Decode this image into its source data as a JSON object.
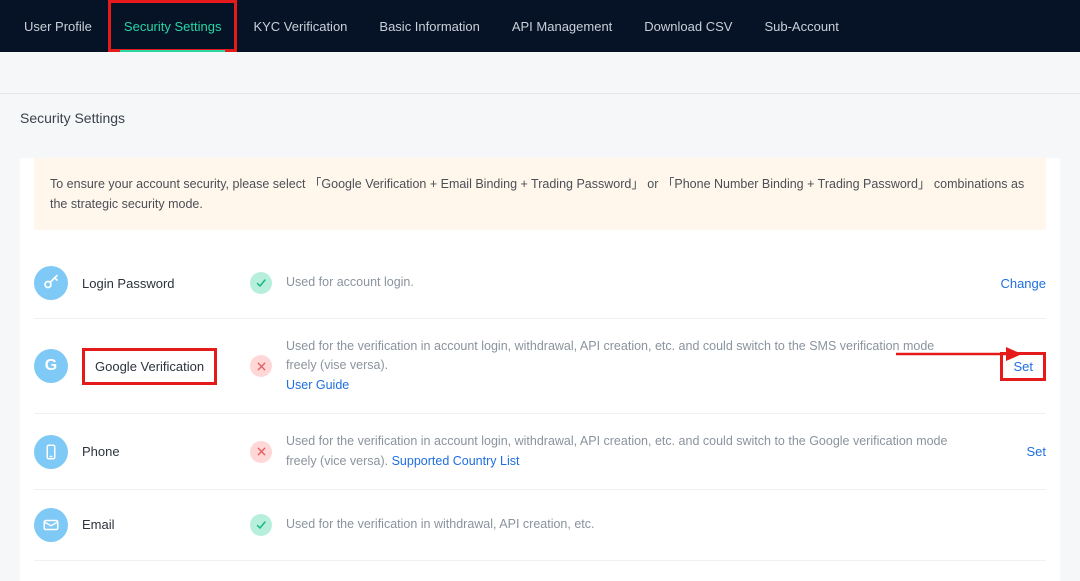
{
  "nav": {
    "tabs": [
      {
        "label": "User Profile"
      },
      {
        "label": "Security Settings"
      },
      {
        "label": "KYC Verification"
      },
      {
        "label": "Basic Information"
      },
      {
        "label": "API Management"
      },
      {
        "label": "Download CSV"
      },
      {
        "label": "Sub-Account"
      }
    ]
  },
  "page_title": "Security Settings",
  "notice": "To ensure your account security, please select 「Google Verification + Email Binding + Trading Password」 or 「Phone Number Binding + Trading Password」 combinations as the strategic security mode.",
  "items": {
    "login_password": {
      "name": "Login Password",
      "desc": "Used for account login.",
      "action": "Change"
    },
    "google_verification": {
      "name": "Google Verification",
      "desc": "Used for the verification in account login, withdrawal, API creation, etc. and could switch to the SMS verification mode freely (vise versa). ",
      "link": "User Guide",
      "action": "Set"
    },
    "phone": {
      "name": "Phone",
      "desc": "Used for the verification in account login, withdrawal, API creation, etc. and could switch to the Google verification mode freely (vice versa). ",
      "link": "Supported Country List",
      "action": "Set"
    },
    "email": {
      "name": "Email",
      "desc": "Used for the verification in withdrawal, API creation, etc."
    }
  }
}
